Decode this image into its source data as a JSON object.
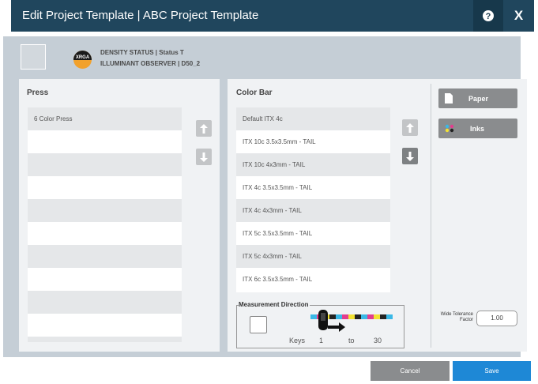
{
  "window": {
    "title": "Edit Project Template | ABC Project Template",
    "help_icon": "question-circle-icon",
    "close_label": "X"
  },
  "status": {
    "logo_text": "XRGA",
    "density": "DENSITY STATUS | Status T",
    "illuminant": "ILLUMINANT OBSERVER | D50_2"
  },
  "press": {
    "label": "Press",
    "items": [
      "6 Color Press",
      "",
      "",
      "",
      "",
      "",
      "",
      "",
      "",
      "",
      ""
    ]
  },
  "color_bar": {
    "label": "Color Bar",
    "items": [
      "Default ITX 4c",
      "ITX 10c 3.5x3.5mm - TAIL",
      "ITX 10c 4x3mm - TAIL",
      "ITX 4c 3.5x3.5mm - TAIL",
      "ITX 4c 4x3mm - TAIL",
      "ITX 5c 3.5x3.5mm - TAIL",
      "ITX 5c 4x3mm - TAIL",
      "ITX 6c 3.5x3.5mm - TAIL"
    ]
  },
  "side": {
    "paper_label": "Paper",
    "inks_label": "Inks"
  },
  "measurement": {
    "label": "Measurement Direction",
    "keys_label": "Keys",
    "from": "1",
    "to_label": "to",
    "to": "30"
  },
  "tolerance": {
    "label_line1": "Wide Tolerance",
    "label_line2": "Factor",
    "value": "1.00"
  },
  "footer": {
    "cancel_label": "Cancel",
    "save_label": "Save"
  },
  "colors": {
    "titlebar": "#20465d",
    "save": "#1e88d6",
    "gray_button": "#8a8c8e"
  }
}
